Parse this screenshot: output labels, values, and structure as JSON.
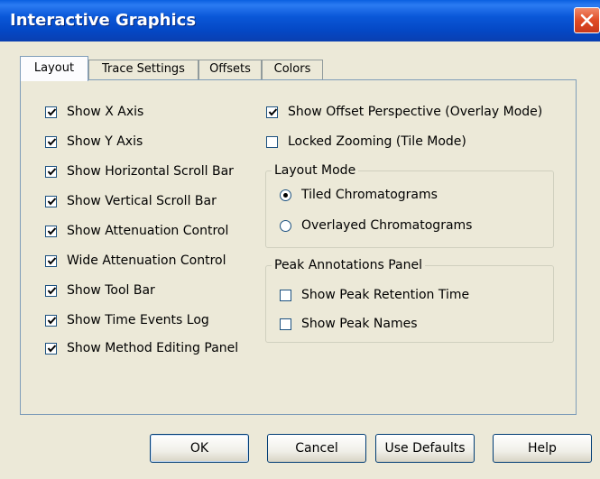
{
  "window": {
    "title": "Interactive Graphics"
  },
  "tabs": [
    {
      "label": "Layout",
      "active": true
    },
    {
      "label": "Trace Settings",
      "active": false
    },
    {
      "label": "Offsets",
      "active": false
    },
    {
      "label": "Colors",
      "active": false
    }
  ],
  "left_options": [
    {
      "label": "Show X Axis",
      "checked": true
    },
    {
      "label": "Show Y Axis",
      "checked": true
    },
    {
      "label": "Show Horizontal Scroll Bar",
      "checked": true
    },
    {
      "label": "Show Vertical Scroll Bar",
      "checked": true
    },
    {
      "label": "Show Attenuation Control",
      "checked": true
    },
    {
      "label": "Wide Attenuation Control",
      "checked": true
    },
    {
      "label": "Show Tool Bar",
      "checked": true
    },
    {
      "label": "Show Time Events Log",
      "checked": true
    },
    {
      "label": "Show Method Editing Panel",
      "checked": true
    }
  ],
  "right_options": [
    {
      "label": "Show Offset Perspective (Overlay Mode)",
      "checked": true
    },
    {
      "label": "Locked Zooming (Tile Mode)",
      "checked": false
    }
  ],
  "layout_mode": {
    "title": "Layout Mode",
    "options": [
      {
        "label": "Tiled Chromatograms",
        "selected": true
      },
      {
        "label": "Overlayed Chromatograms",
        "selected": false
      }
    ]
  },
  "peak_annotations": {
    "title": "Peak Annotations Panel",
    "options": [
      {
        "label": "Show Peak Retention Time",
        "checked": false
      },
      {
        "label": "Show Peak Names",
        "checked": false
      }
    ]
  },
  "buttons": {
    "ok": "OK",
    "cancel": "Cancel",
    "defaults": "Use Defaults",
    "help": "Help"
  }
}
